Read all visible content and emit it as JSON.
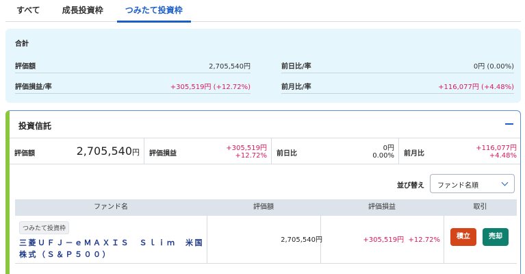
{
  "tabs": [
    {
      "label": "すべて"
    },
    {
      "label": "成長投資枠"
    },
    {
      "label": "つみたて投資枠"
    }
  ],
  "summary": {
    "title": "合計",
    "valuation_label": "評価額",
    "valuation_value": "2,705,540円",
    "daily_label": "前日比/率",
    "daily_value": "0円 (0.00%)",
    "pl_label": "評価損益/率",
    "pl_value": "+305,519円 (+12.72%)",
    "monthly_label": "前月比/率",
    "monthly_value": "+116,077円 (+4.48%)"
  },
  "section": {
    "title": "投資信託",
    "valuation_label": "評価額",
    "valuation_number": "2,705,540",
    "valuation_unit": "円",
    "pl_label": "評価損益",
    "pl_amount": "+305,519円",
    "pl_rate": "+12.72%",
    "daily_label": "前日比",
    "daily_amount": "0円",
    "daily_rate": "0.00%",
    "monthly_label": "前月比",
    "monthly_amount": "+116,077円",
    "monthly_rate": "+4.48%",
    "sort_label": "並び替え",
    "sort_selected": "ファンド名順"
  },
  "table": {
    "headers": [
      "ファンド名",
      "評価額",
      "評価損益",
      "取引"
    ],
    "rows": [
      {
        "badge": "つみたて投資枠",
        "fund_name": "三菱ＵＦＪ－ｅＭＡＸＩＳ　Ｓｌｉｍ　米国株式（Ｓ＆Ｐ５００）",
        "valuation": "2,705,540円",
        "pl_amount": "+305,519円",
        "pl_rate": "+12.72%",
        "buy_label": "積立",
        "sell_label": "売却"
      }
    ]
  },
  "colors": {
    "accent": "#1a5fc8",
    "positive": "#d9185a",
    "buy": "#d5451a",
    "sell": "#0f7f6e",
    "summary_bg": "#e6f6fd",
    "section_bar": "#8cc63f"
  }
}
